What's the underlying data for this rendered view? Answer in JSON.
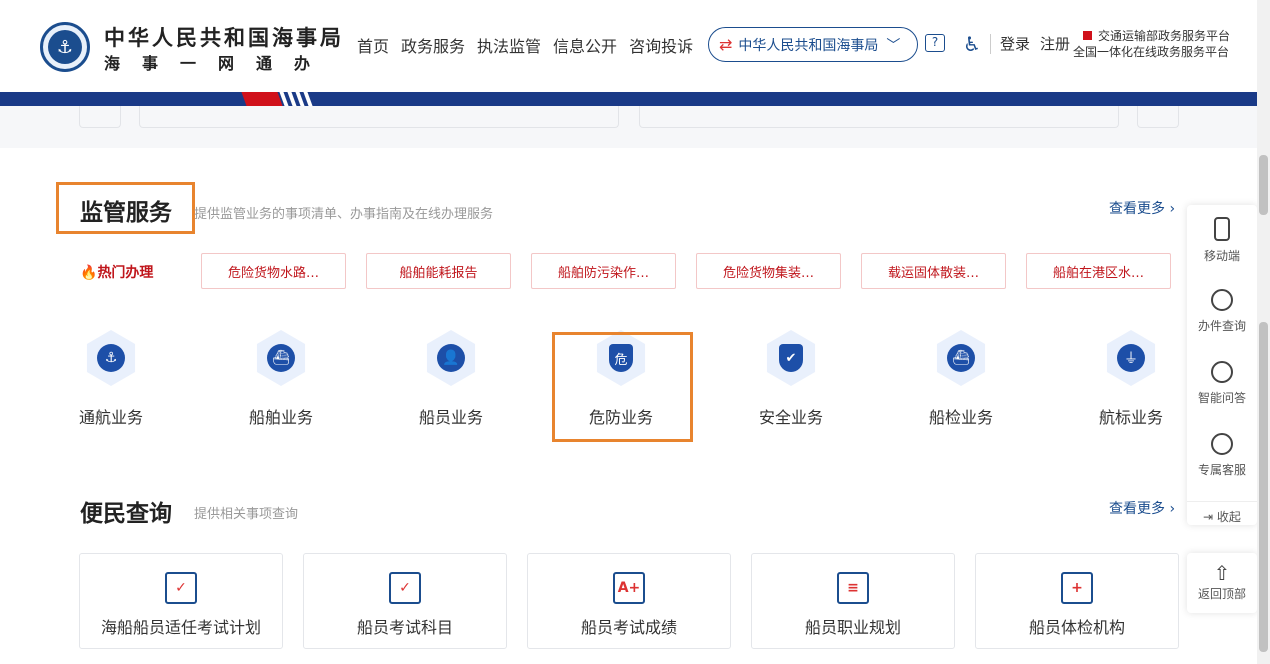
{
  "header": {
    "logo_title": "中华人民共和国海事局",
    "logo_subtitle": "海事一网通办",
    "nav": [
      "首页",
      "政务服务",
      "执法监管",
      "信息公开",
      "咨询投诉"
    ],
    "org_select": "中华人民共和国海事局",
    "login": "登录",
    "register": "注册",
    "platform_line1": "交通运输部政务服务平台",
    "platform_line2": "全国一体化在线政务服务平台"
  },
  "supervision": {
    "title": "监管服务",
    "desc": "提供监管业务的事项清单、办事指南及在线办理服务",
    "more": "查看更多 ›",
    "hot_label": "热门办理",
    "hot_items": [
      "危险货物水路…",
      "船舶能耗报告",
      "船舶防污染作…",
      "危险货物集装…",
      "载运固体散装…",
      "船舶在港区水…"
    ],
    "services": [
      {
        "label": "通航业务",
        "icon": "anchor-icon",
        "glyph": "⚓"
      },
      {
        "label": "船舶业务",
        "icon": "ship-icon",
        "glyph": "⛴"
      },
      {
        "label": "船员业务",
        "icon": "crew-icon",
        "glyph": "👤"
      },
      {
        "label": "危防业务",
        "icon": "hazard-shield-icon",
        "glyph": "危"
      },
      {
        "label": "安全业务",
        "icon": "safety-shield-icon",
        "glyph": "✔"
      },
      {
        "label": "船检业务",
        "icon": "ship-inspection-icon",
        "glyph": "⛴"
      },
      {
        "label": "航标业务",
        "icon": "lighthouse-icon",
        "glyph": "⏚"
      }
    ]
  },
  "convenience": {
    "title": "便民查询",
    "desc": "提供相关事项查询",
    "more": "查看更多 ›",
    "cards": [
      {
        "label": "海船船员适任考试计划",
        "glyph": "✓"
      },
      {
        "label": "船员考试科目",
        "glyph": "✓"
      },
      {
        "label": "船员考试成绩",
        "glyph": "A+"
      },
      {
        "label": "船员职业规划",
        "glyph": "≡"
      },
      {
        "label": "船员体检机构",
        "glyph": "+"
      }
    ]
  },
  "float_bar": {
    "items": [
      "移动端",
      "办件查询",
      "智能问答",
      "专属客服"
    ],
    "collapse": "收起",
    "back_top": "返回顶部"
  }
}
